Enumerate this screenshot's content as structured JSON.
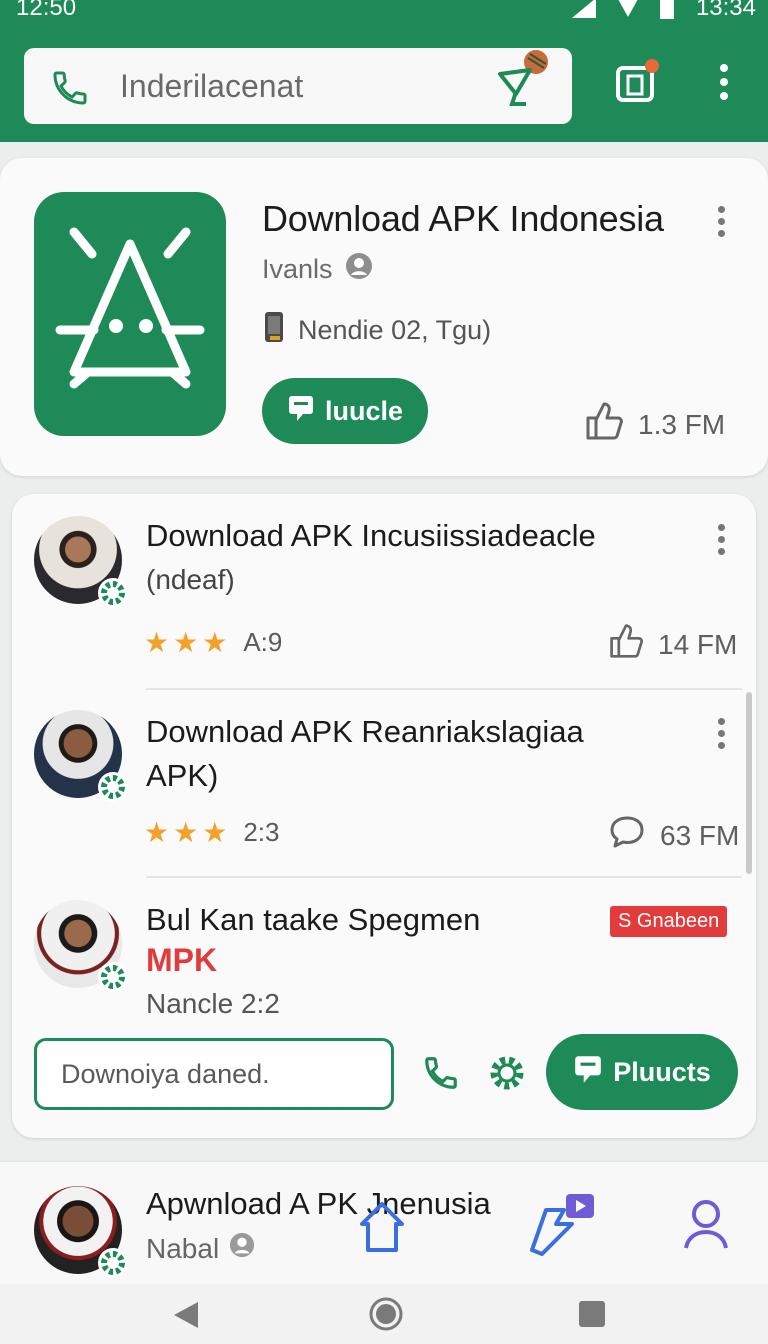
{
  "status_bar": {
    "time": "12:50",
    "right_time": "13:34"
  },
  "header": {
    "search_placeholder": "Inderilacenat",
    "icons": [
      "phone-icon",
      "satellite-dish-icon",
      "store-icon",
      "more-vert-icon"
    ]
  },
  "hero": {
    "title": "Download APK Indonesia",
    "developer": "Ivanls",
    "meta": "Nendie 02, Tgu)",
    "button_label": "luucle",
    "likes": "1.3 FM"
  },
  "list": [
    {
      "title": "Download APK Incusiissiadeacle",
      "subtitle": "(ndeaf)",
      "rating_text": "A:9",
      "count": "14 FM",
      "stars": 3
    },
    {
      "title": "Download APK  Reanriakslagiaa",
      "subtitle": "APK)",
      "rating_text": "2:3",
      "count": "63 FM",
      "stars": 3
    },
    {
      "title": "Bul Kan taake Spegmen",
      "highlight": "MPK",
      "subtitle": "Nancle  2:2",
      "tag": "S Gnabeen"
    }
  ],
  "action_row": {
    "input_placeholder": "Downoiya daned.",
    "button_label": "Pluucts"
  },
  "bottom_item": {
    "title": "Apwnload A PK Jnenusia",
    "subtitle": "Nabal"
  },
  "colors": {
    "primary": "#1e8a57",
    "accent_red": "#e13b3b",
    "star": "#f2a22a",
    "nav_purple": "#6f5bd6"
  }
}
